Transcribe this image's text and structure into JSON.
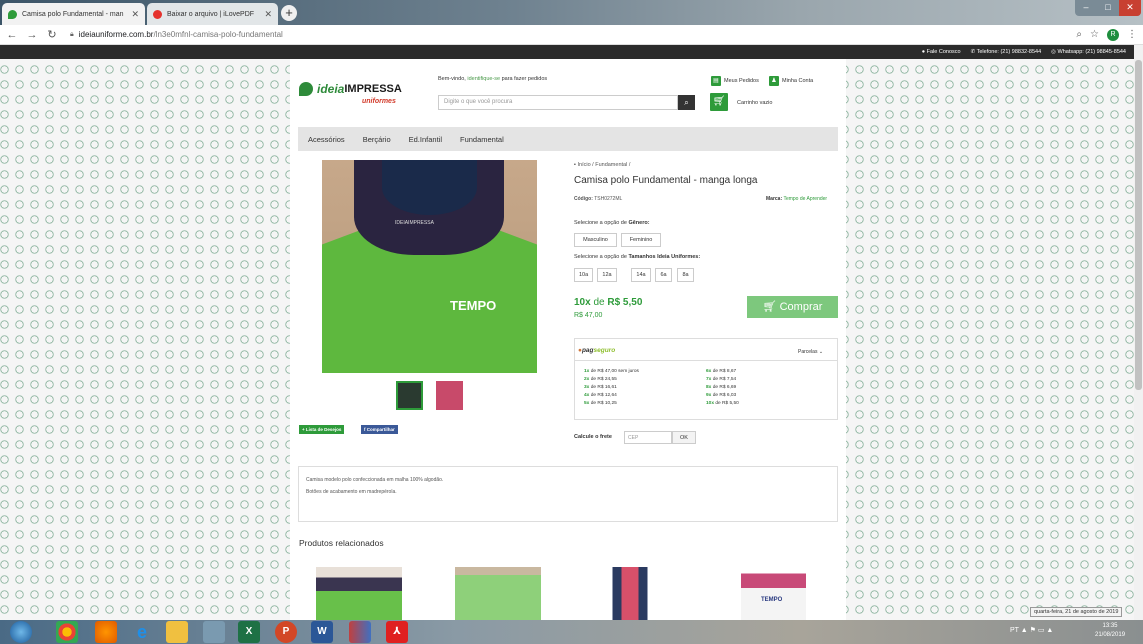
{
  "browser": {
    "tabs": [
      {
        "title": "Camisa polo Fundamental - man",
        "active": true,
        "favicon_color": "#2e9b3a"
      },
      {
        "title": "Baixar o arquivo | iLovePDF",
        "active": false,
        "favicon_color": "#e5322d"
      }
    ],
    "url_domain": "ideiauniforme.com.br",
    "url_path": "/ln3e0mfnl-camisa-polo-fundamental",
    "profile_initial": "R"
  },
  "topbar": {
    "contact": "Fale Conosco",
    "phone": "Telefone: (21) 98832-8544",
    "whatsapp": "Whatsapp: (21) 98845-8544"
  },
  "header": {
    "logo_ideia": "ideia",
    "logo_impressa": "IMPRESSA",
    "logo_sub": "uniformes",
    "welcome_prefix": "Bem-vindo,",
    "welcome_link": "identifique-se",
    "welcome_suffix": "para fazer pedidos",
    "search_placeholder": "Digite o que você procura",
    "my_orders": "Meus Pedidos",
    "my_account": "Minha Conta",
    "cart": "Carrinho vazio"
  },
  "menu": [
    "Acessórios",
    "Berçário",
    "Ed.Infantil",
    "Fundamental"
  ],
  "product": {
    "breadcrumb": "Início / Fundamental /",
    "title": "Camisa polo Fundamental - manga longa",
    "code_label": "Código:",
    "code": "TSH0272ML",
    "brand_label": "Marca:",
    "brand": "Tempo de Aprender",
    "gender_label_prefix": "Selecione a opção de",
    "gender_label_bold": "Gênero:",
    "genders": [
      "Masculino",
      "Feminino"
    ],
    "size_label_prefix": "Selecione a opção de",
    "size_label_bold": "Tamanhos Ideia Uniformes:",
    "sizes": [
      "10a",
      "12a",
      "14a",
      "6a",
      "8a"
    ],
    "installment_prefix": "10x",
    "installment_mid": "de",
    "installment_value": "R$ 5,50",
    "cash_price": "R$ 47,00",
    "buy_label": "Comprar",
    "shirt_print": "TEMPO",
    "shirt_label": "IDEIAIMPRESSA"
  },
  "pagseguro": {
    "logo_a": "pag",
    "logo_b": "seguro",
    "parcelas": "Parcelas ⌄",
    "left": [
      {
        "n": "1x",
        "t": "de R$ 47,00 sem juros"
      },
      {
        "n": "2x",
        "t": "de R$ 24,55"
      },
      {
        "n": "3x",
        "t": "de R$ 16,61"
      },
      {
        "n": "4x",
        "t": "de R$ 12,64"
      },
      {
        "n": "5x",
        "t": "de R$ 10,25"
      }
    ],
    "right": [
      {
        "n": "6x",
        "t": "de R$ 8,67"
      },
      {
        "n": "7x",
        "t": "de R$ 7,54"
      },
      {
        "n": "8x",
        "t": "de R$ 6,69"
      },
      {
        "n": "9x",
        "t": "de R$ 6,03"
      },
      {
        "n": "10x",
        "t": "de R$ 5,50"
      }
    ]
  },
  "actions": {
    "wishlist": "+ Lista de Desejos",
    "share": "Compartilhar"
  },
  "shipping": {
    "label": "Calcule o frete",
    "cep_placeholder": "CEP",
    "ok": "OK"
  },
  "description": [
    "Camisa modelo polo confeccionada em malha 100% algodão.",
    "Botões de acabamento em madrepérola."
  ],
  "related_title": "Produtos relacionados",
  "related_print": "TEMPO",
  "taskbar": {
    "clock_time": "13:35",
    "clock_date": "21/08/2019",
    "tooltip": "quarta-feira, 21 de agosto de 2019",
    "tray": "PT ▲ ⚑ ▭ ▲"
  }
}
